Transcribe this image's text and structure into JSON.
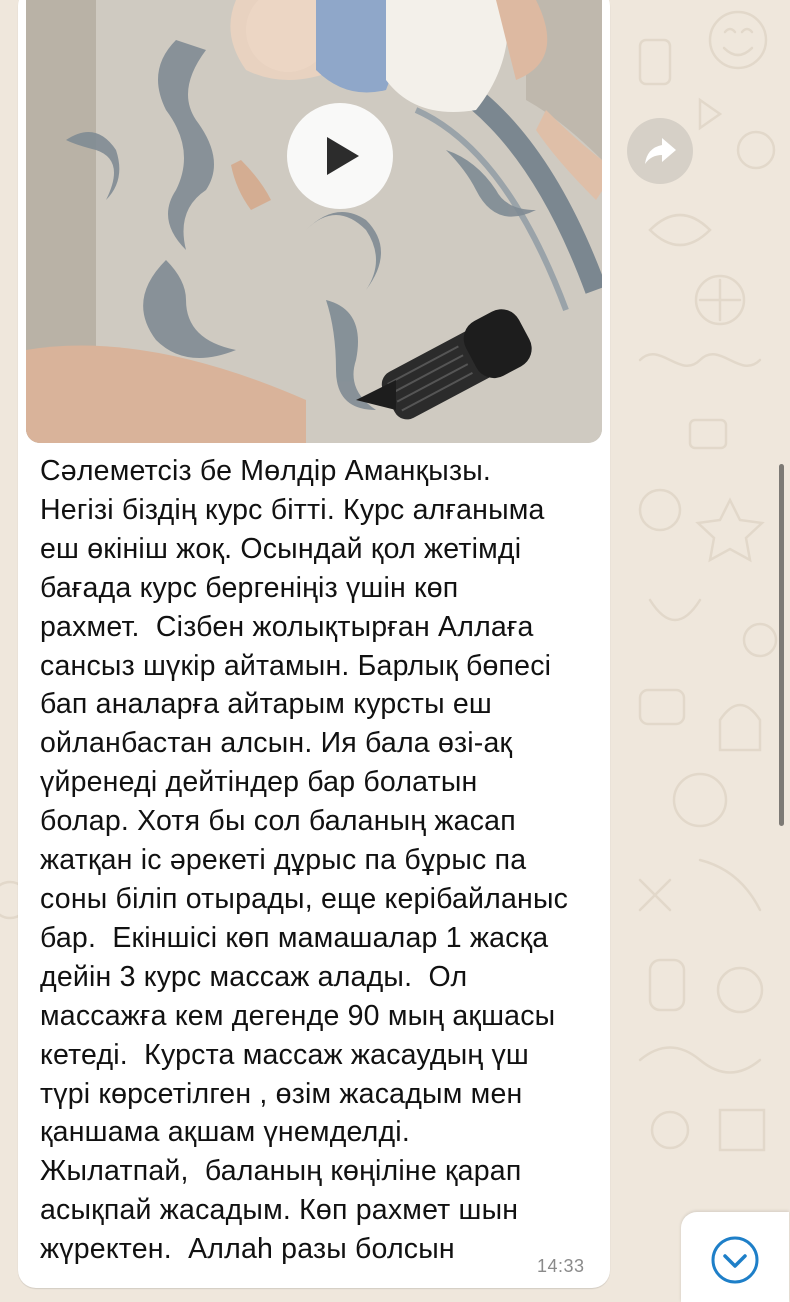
{
  "chat": {
    "message": {
      "text": "Сәлеметсіз бе Мөлдір Аманқызы.\nНегізі біздің курс бітті. Курс алғаныма\nеш өкініш жоқ. Осындай қол жетімді\nбағада курс бергеніңіз үшін көп\nрахмет.  Сізбен жолықтырған Аллаға\nсансыз шүкір айтамын. Барлық бөпесі\nбап аналарға айтарым курсты еш\nойланбастан алсын. Ия бала өзі-ақ\nүйренеді дейтіндер бар болатын\nболар. Хотя бы сол баланың жасап\nжатқан іс әрекеті дұрыс па бұрыс па\nсоны біліп отырады, еще керібайланыс\nбар.  Екіншісі көп мамашалар 1 жасқа\nдейін 3 курс массаж алады.  Ол\nмассажға кем дегенде 90 мың ақшасы\nкетеді.  Курста массаж жасаудың үш\nтүрі көрсетілген , өзім жасадым мен\nқаншама ақшам үнемделді.\nЖылатпай,  баланың көңіліне қарап\nасықпай жасадым. Көп рахмет шын\nжүректен.  Аллаһ разы болсын",
      "time": "14:33"
    },
    "icons": {
      "play": "play-icon",
      "forward": "forward-icon",
      "scroll_down": "chevron-down-icon"
    },
    "colors": {
      "background": "#efe7dc",
      "bubble": "#ffffff",
      "accent": "#1e7fc8"
    }
  }
}
